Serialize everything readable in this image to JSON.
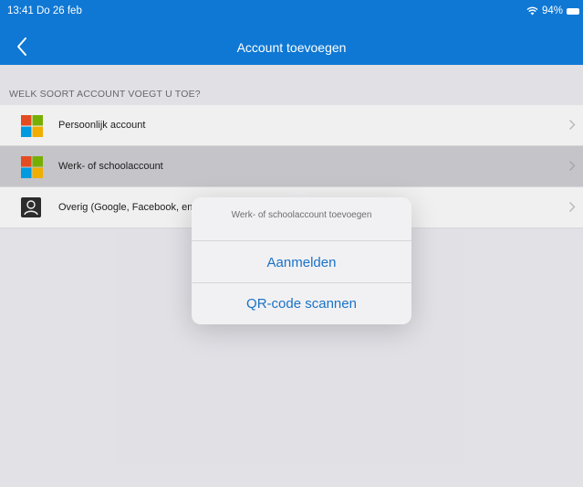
{
  "status_bar": {
    "time_date": "13:41  Do 26 feb",
    "battery": "94%",
    "wifi_icon": "wifi-icon",
    "battery_icon": "battery-icon"
  },
  "nav": {
    "back_icon": "chevron-left-icon",
    "title": "Account toevoegen",
    "bar_color": "#0f78d4"
  },
  "section": {
    "header": "WELK SOORT ACCOUNT VOEGT U TOE?"
  },
  "accounts": [
    {
      "label": "Persoonlijk account",
      "icon": "microsoft-logo-icon"
    },
    {
      "label": "Werk- of schoolaccount",
      "icon": "microsoft-logo-icon",
      "selected": true
    },
    {
      "label": "Overig (Google, Facebook, enz.)",
      "icon": "person-icon"
    }
  ],
  "popover": {
    "title": "Werk- of schoolaccount toevoegen",
    "signin_label": "Aanmelden",
    "qr_label": "QR-code scannen",
    "accent": "#1a72c8"
  }
}
